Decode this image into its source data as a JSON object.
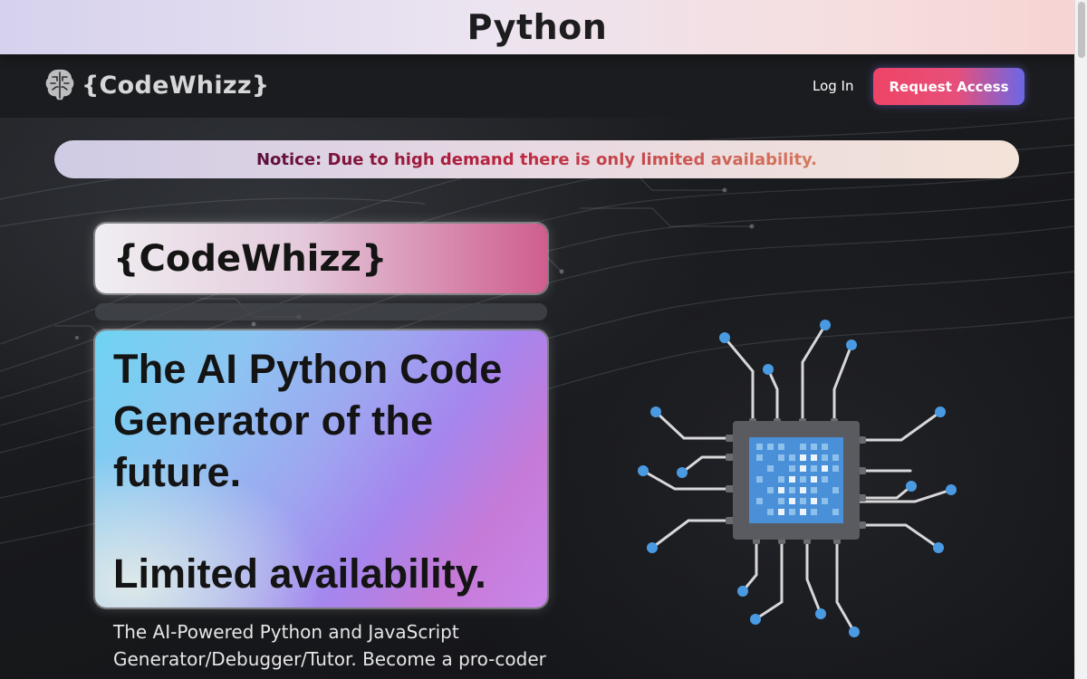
{
  "page": {
    "title": "Python"
  },
  "navbar": {
    "brand_text": "{CodeWhizz}",
    "brand_icon": "brain-icon",
    "login_label": "Log In",
    "request_access_label": "Request Access"
  },
  "notice": {
    "text": "Notice: Due to high demand there is only limited availability."
  },
  "hero": {
    "brand_card_text": "{CodeWhizz}",
    "headline_lines": [
      "The AI Python Code",
      "Generator of the",
      "future."
    ],
    "availability_text": "Limited availability.",
    "subtitle": "The AI-Powered Python and JavaScript Generator/Debugger/Tutor. Become a pro-coder",
    "illustration_icon": "cpu-chip-icon"
  },
  "colors": {
    "accent_red": "#ee4466",
    "accent_blue": "#6b67e6",
    "chip_blue": "#4a90d9",
    "navbar_bg": "#1b1c1f"
  }
}
